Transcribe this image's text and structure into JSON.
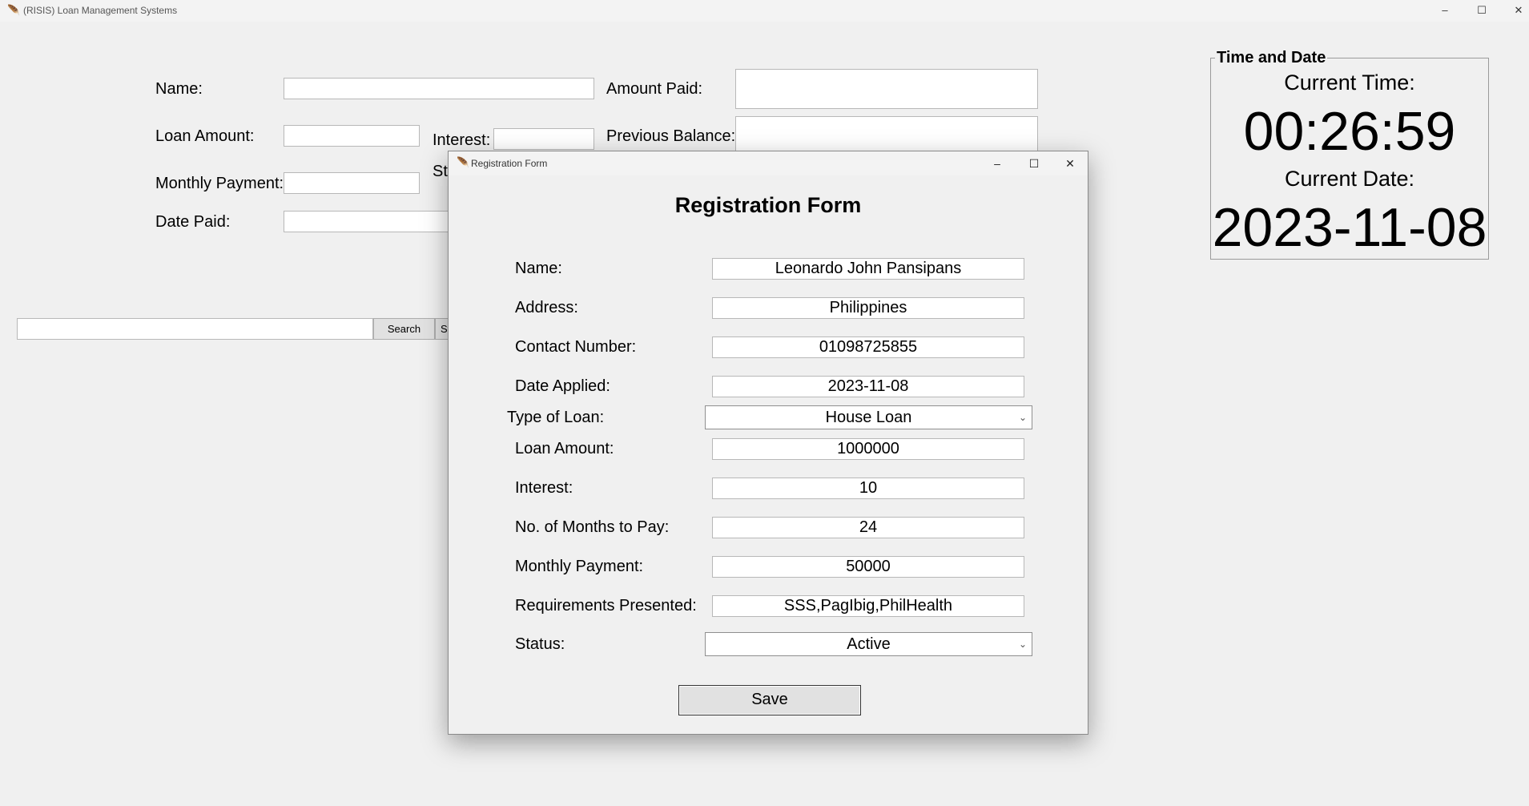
{
  "window": {
    "title": "(RISIS) Loan Management Systems",
    "controls": {
      "minimize": "–",
      "maximize": "☐",
      "close": "✕"
    }
  },
  "main_form": {
    "name_label": "Name:",
    "loan_amount_label": "Loan Amount:",
    "interest_label": "Interest:",
    "monthly_payment_label": "Monthly Payment:",
    "status_label_partial": "St",
    "date_paid_label": "Date Paid:",
    "amount_paid_label": "Amount Paid:",
    "previous_balance_label": "Previous Balance:"
  },
  "search": {
    "input_value": "",
    "button_label": "Search",
    "next_button_partial": "St"
  },
  "time_panel": {
    "legend": "Time and Date",
    "time_label": "Current Time:",
    "time_value": "00:26:59",
    "date_label": "Current Date:",
    "date_value": "2023-11-08"
  },
  "dialog": {
    "title": "Registration Form",
    "heading": "Registration Form",
    "controls": {
      "minimize": "–",
      "maximize": "☐",
      "close": "✕"
    },
    "fields": [
      {
        "label": "Name:",
        "value": "Leonardo John Pansipans"
      },
      {
        "label": "Address:",
        "value": "Philippines"
      },
      {
        "label": "Contact Number:",
        "value": "01098725855"
      },
      {
        "label": "Date Applied:",
        "value": "2023-11-08"
      },
      {
        "label": "Type of Loan:",
        "value": "House Loan"
      },
      {
        "label": "Loan Amount:",
        "value": "1000000"
      },
      {
        "label": "Interest:",
        "value": "10"
      },
      {
        "label": "No. of Months to Pay:",
        "value": "24"
      },
      {
        "label": "Monthly Payment:",
        "value": "50000"
      },
      {
        "label": "Requirements Presented:",
        "value": "SSS,PagIbig,PhilHealth"
      },
      {
        "label": "Status:",
        "value": "Active"
      }
    ],
    "save_label": "Save"
  }
}
